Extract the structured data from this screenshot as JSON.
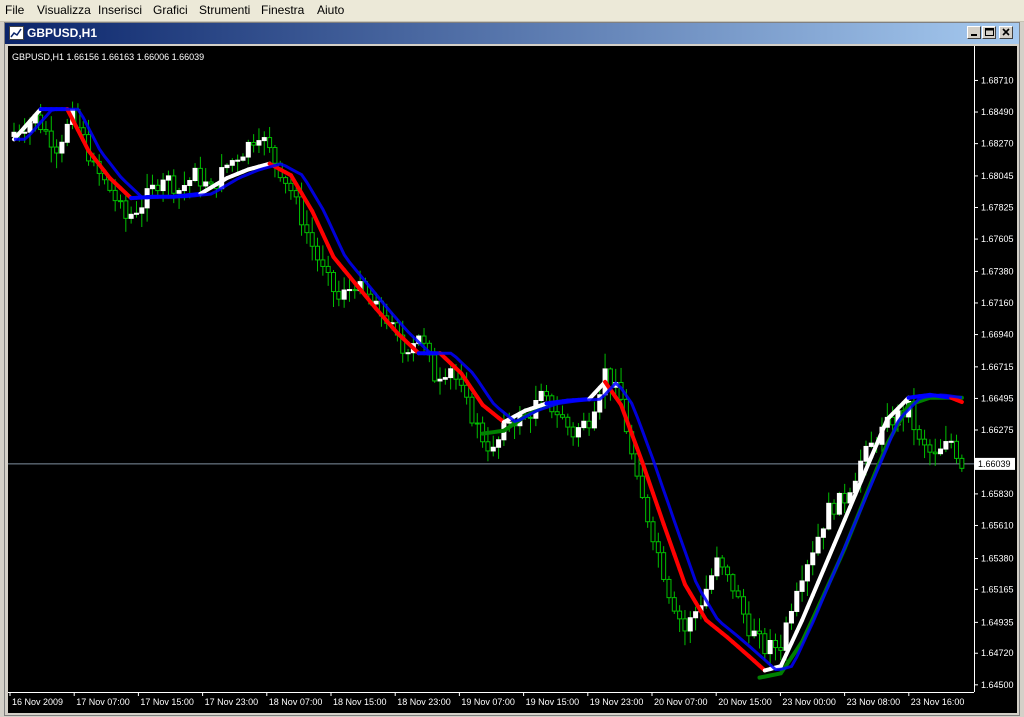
{
  "menu": [
    "File",
    "Visualizza",
    "Inserisci",
    "Grafici",
    "Strumenti",
    "Finestra",
    "Aiuto"
  ],
  "window": {
    "title": "GBPUSD,H1",
    "info": "GBPUSD,H1  1.66156 1.66163 1.66006 1.66039"
  },
  "colors": {
    "bull": "#ffffff",
    "bear": "#00c000",
    "wick": "#00c000",
    "axis_text": "#ffffff",
    "grid": "#ffffff",
    "price_line": "#8090a0",
    "ma_up": "#ffffff",
    "ma_down": "#ff0000",
    "ma_flat": "#0000ff",
    "ma_slow": "#008000",
    "background": "#000000"
  },
  "chart_data": {
    "type": "candlestick",
    "symbol": "GBPUSD",
    "timeframe": "H1",
    "ylim": [
      1.6445,
      1.6895
    ],
    "y_ticks": [
      1.6871,
      1.6849,
      1.6827,
      1.68045,
      1.67825,
      1.67605,
      1.6738,
      1.6716,
      1.6694,
      1.66715,
      1.66495,
      1.66275,
      1.6583,
      1.6561,
      1.6538,
      1.65165,
      1.64935,
      1.6472,
      1.645
    ],
    "y_tick_labels": [
      "1.68710",
      "1.68490",
      "1.68270",
      "1.68045",
      "1.67825",
      "1.67605",
      "1.67380",
      "1.67160",
      "1.66940",
      "1.66715",
      "1.66495",
      "1.66275",
      "1.65830",
      "1.65610",
      "1.65380",
      "1.65165",
      "1.64935",
      "1.64720",
      "1.64500"
    ],
    "current_price": 1.66039,
    "current_price_label": "1.66039",
    "x_labels": [
      "16 Nov 2009",
      "17 Nov 07:00",
      "17 Nov 15:00",
      "17 Nov 23:00",
      "18 Nov 07:00",
      "18 Nov 15:00",
      "18 Nov 23:00",
      "19 Nov 07:00",
      "19 Nov 15:00",
      "19 Nov 23:00",
      "20 Nov 07:00",
      "20 Nov 15:00",
      "23 Nov 00:00",
      "23 Nov 08:00",
      "23 Nov 16:00"
    ],
    "close_waypoints": [
      [
        0,
        1.6835
      ],
      [
        4,
        1.6845
      ],
      [
        8,
        1.6825
      ],
      [
        11,
        1.6845
      ],
      [
        13,
        1.683
      ],
      [
        15,
        1.681
      ],
      [
        18,
        1.6795
      ],
      [
        21,
        1.6775
      ],
      [
        24,
        1.6785
      ],
      [
        28,
        1.6805
      ],
      [
        31,
        1.6795
      ],
      [
        34,
        1.6805
      ],
      [
        37,
        1.6795
      ],
      [
        40,
        1.6812
      ],
      [
        43,
        1.6822
      ],
      [
        46,
        1.6835
      ],
      [
        49,
        1.6815
      ],
      [
        52,
        1.6795
      ],
      [
        55,
        1.6765
      ],
      [
        58,
        1.6738
      ],
      [
        61,
        1.6718
      ],
      [
        64,
        1.673
      ],
      [
        67,
        1.6715
      ],
      [
        70,
        1.6705
      ],
      [
        73,
        1.6682
      ],
      [
        76,
        1.6695
      ],
      [
        79,
        1.6665
      ],
      [
        82,
        1.6672
      ],
      [
        85,
        1.6645
      ],
      [
        88,
        1.6622
      ],
      [
        90,
        1.6612
      ],
      [
        93,
        1.6635
      ],
      [
        96,
        1.6635
      ],
      [
        99,
        1.665
      ],
      [
        102,
        1.664
      ],
      [
        105,
        1.6625
      ],
      [
        108,
        1.6635
      ],
      [
        111,
        1.6668
      ],
      [
        114,
        1.6648
      ],
      [
        117,
        1.659
      ],
      [
        120,
        1.6555
      ],
      [
        123,
        1.6515
      ],
      [
        126,
        1.6488
      ],
      [
        129,
        1.6508
      ],
      [
        132,
        1.6535
      ],
      [
        135,
        1.6518
      ],
      [
        138,
        1.649
      ],
      [
        141,
        1.6475
      ],
      [
        144,
        1.6478
      ],
      [
        147,
        1.652
      ],
      [
        150,
        1.6545
      ],
      [
        153,
        1.6572
      ],
      [
        156,
        1.658
      ],
      [
        159,
        1.6605
      ],
      [
        162,
        1.6622
      ],
      [
        165,
        1.6635
      ],
      [
        168,
        1.6642
      ],
      [
        170,
        1.6618
      ],
      [
        173,
        1.6608
      ],
      [
        176,
        1.662
      ],
      [
        178,
        1.66039
      ]
    ],
    "ma_fast_waypoints": [
      [
        0,
        1.683
      ],
      [
        5,
        1.6851
      ],
      [
        10,
        1.6851
      ],
      [
        14,
        1.6822
      ],
      [
        18,
        1.6803
      ],
      [
        22,
        1.6789
      ],
      [
        26,
        1.679
      ],
      [
        30,
        1.679
      ],
      [
        35,
        1.6792
      ],
      [
        40,
        1.6803
      ],
      [
        44,
        1.6809
      ],
      [
        48,
        1.6813
      ],
      [
        52,
        1.6805
      ],
      [
        56,
        1.678
      ],
      [
        60,
        1.6748
      ],
      [
        64,
        1.673
      ],
      [
        68,
        1.6712
      ],
      [
        72,
        1.6695
      ],
      [
        76,
        1.6681
      ],
      [
        80,
        1.6681
      ],
      [
        84,
        1.6667
      ],
      [
        88,
        1.6645
      ],
      [
        92,
        1.6633
      ],
      [
        96,
        1.6641
      ],
      [
        100,
        1.6646
      ],
      [
        104,
        1.6648
      ],
      [
        108,
        1.6649
      ],
      [
        111,
        1.6661
      ],
      [
        114,
        1.6645
      ],
      [
        118,
        1.6605
      ],
      [
        122,
        1.6562
      ],
      [
        126,
        1.652
      ],
      [
        130,
        1.6495
      ],
      [
        134,
        1.6483
      ],
      [
        138,
        1.647
      ],
      [
        141,
        1.646
      ],
      [
        144,
        1.6463
      ],
      [
        148,
        1.6495
      ],
      [
        152,
        1.653
      ],
      [
        156,
        1.6565
      ],
      [
        160,
        1.66
      ],
      [
        164,
        1.6635
      ],
      [
        168,
        1.665
      ],
      [
        172,
        1.6652
      ],
      [
        176,
        1.665
      ],
      [
        178,
        1.6647
      ]
    ],
    "ma_slow_waypoints": [
      [
        88,
        1.6625
      ],
      [
        92,
        1.6627
      ],
      [
        96,
        1.6637
      ],
      [
        100,
        1.6645
      ],
      [
        104,
        1.6648
      ],
      [
        140,
        1.6455
      ],
      [
        144,
        1.6458
      ],
      [
        148,
        1.648
      ],
      [
        152,
        1.6512
      ],
      [
        156,
        1.6545
      ],
      [
        160,
        1.6582
      ],
      [
        164,
        1.6618
      ],
      [
        168,
        1.6645
      ],
      [
        172,
        1.665
      ],
      [
        176,
        1.665
      ],
      [
        178,
        1.665
      ]
    ]
  }
}
